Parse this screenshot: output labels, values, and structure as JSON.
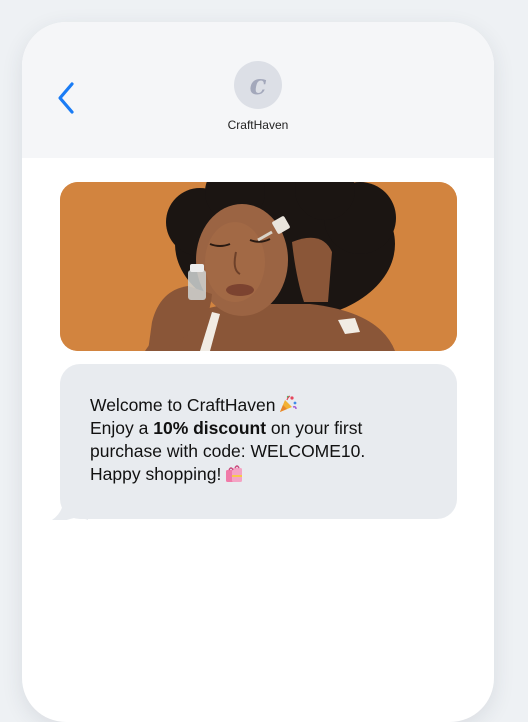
{
  "header": {
    "back_icon": "chevron-left-icon",
    "avatar_letter": "c",
    "contact_name": "CraftHaven"
  },
  "media": {
    "icon": "promo-photo-woman-applying-serum",
    "background_color": "#d2843f"
  },
  "message": {
    "line1": "Welcome to CraftHaven",
    "line2_before": "Enjoy a ",
    "line2_bold": "10% discount",
    "line2_after": " on your first",
    "line3": "purchase with code: WELCOME10.",
    "line4": "Happy shopping!",
    "emoji_1": "party-popper-icon",
    "emoji_2": "shopping-bags-icon"
  },
  "colors": {
    "accent": "#1a7cf5",
    "bubble": "#e8ebef",
    "header_bg": "#f5f6f8"
  }
}
